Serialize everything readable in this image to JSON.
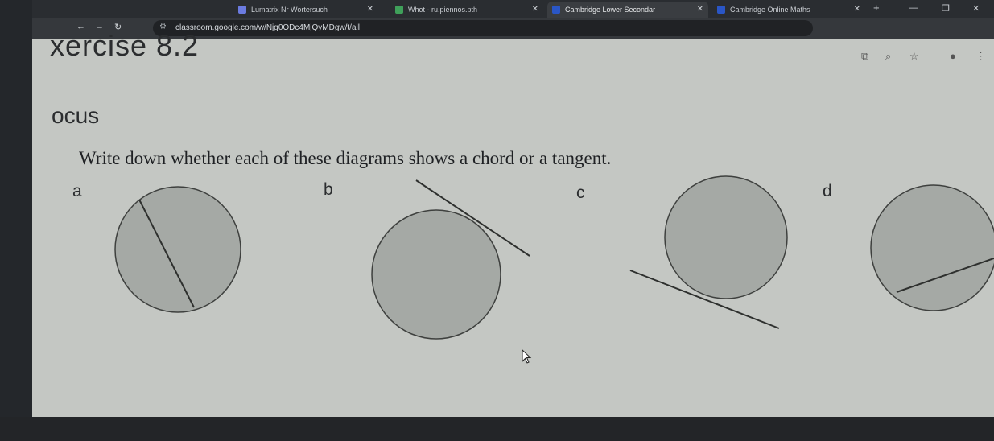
{
  "browser": {
    "tabs": [
      {
        "label": "Lumatrix Nr Wortersuch",
        "active": false,
        "color": "#6b7be0"
      },
      {
        "label": "Whot - ru.piennos.pth",
        "active": false,
        "color": "#3fa05a"
      },
      {
        "label": "Cambridge Lower Secondar",
        "active": true,
        "color": "#2a56c6"
      },
      {
        "label": "Cambridge Online Maths",
        "active": false,
        "color": "#2a56c6"
      }
    ],
    "url": "classroom.google.com/w/Njg0ODc4MjQyMDgw/t/all"
  },
  "page": {
    "heading": "xercise 8.2",
    "section": "ocus",
    "instruction": "Write down whether each of these diagrams shows a chord or a tangent.",
    "labels": [
      "a",
      "b",
      "c",
      "d"
    ]
  },
  "colors": {
    "page_bg": "#c4c7c3",
    "circle_fill": "#a5a9a5",
    "circle_stroke": "#3e403e"
  }
}
